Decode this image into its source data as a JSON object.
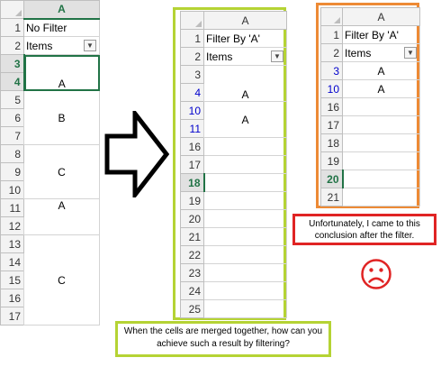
{
  "sheet1": {
    "column": "A",
    "rows": [
      {
        "num": "1",
        "text": ""
      },
      {
        "num": "2",
        "text": ""
      },
      {
        "num": "3",
        "text": ""
      },
      {
        "num": "4",
        "text": ""
      },
      {
        "num": "5",
        "text": ""
      },
      {
        "num": "6",
        "text": ""
      },
      {
        "num": "7",
        "text": ""
      },
      {
        "num": "8",
        "text": ""
      },
      {
        "num": "9",
        "text": ""
      },
      {
        "num": "10",
        "text": ""
      },
      {
        "num": "11",
        "text": ""
      },
      {
        "num": "12",
        "text": ""
      },
      {
        "num": "13",
        "text": ""
      },
      {
        "num": "14",
        "text": ""
      },
      {
        "num": "15",
        "text": ""
      },
      {
        "num": "16",
        "text": ""
      },
      {
        "num": "17",
        "text": ""
      }
    ],
    "title_cell": "No Filter",
    "header_cell": "Items",
    "values": {
      "r4": "A",
      "r6": "B",
      "r9": "C",
      "r11": "A",
      "r15": "C"
    }
  },
  "sheet2": {
    "column": "A",
    "row_numbers": [
      "1",
      "2",
      "3",
      "4",
      "10",
      "11",
      "16",
      "17",
      "18",
      "19",
      "20",
      "21",
      "22",
      "23",
      "24",
      "25"
    ],
    "title_cell": "Filter By 'A'",
    "header_cell": "Items",
    "values": {
      "r4": "A",
      "r11": "A"
    }
  },
  "sheet3": {
    "column": "A",
    "row_numbers": [
      "1",
      "2",
      "3",
      "10",
      "16",
      "17",
      "18",
      "19",
      "20",
      "21"
    ],
    "title_cell": "Filter By 'A'",
    "header_cell": "Items",
    "values": {
      "r3": "A",
      "r10": "A"
    }
  },
  "notes": {
    "red": "Unfortunately, I came to this conclusion after the filter.",
    "green": "When the cells are merged together, how can you achieve such a result by filtering?"
  },
  "icons": {
    "arrow": "right-arrow-icon",
    "sad": "sad-face-icon",
    "filter": "filter-dropdown-icon"
  },
  "colors": {
    "green_frame": "#b5d334",
    "orange_frame": "#ed8a35",
    "red_note": "#e02424",
    "excel_green": "#217346",
    "filtered_row_blue": "#0000cc"
  }
}
